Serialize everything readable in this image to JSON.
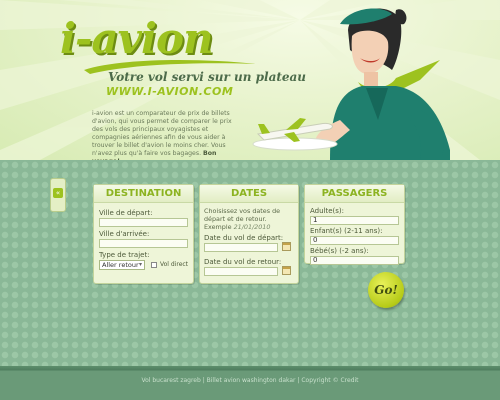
{
  "header": {
    "logo": "i-avion",
    "tagline": "Votre vol servi sur un plateau",
    "url": "WWW.I-AVION.COM",
    "intro": "i-avion est un comparateur de prix de billets d'avion, qui vous permet de comparer le prix des vols des principaux voyagistes et compagnies aériennes afin de vous aider à trouver le billet d'avion le moins cher. Vous n'avez plus qu'à faire vos bagages.",
    "intro_bold": "Bon voyage!"
  },
  "destination": {
    "title": "Destination",
    "departure_label": "Ville de départ:",
    "departure_value": "",
    "arrival_label": "Ville d'arrivée:",
    "arrival_value": "",
    "trip_type_label": "Type de trajet:",
    "trip_type_value": "Aller retour",
    "direct_label": "Vol direct"
  },
  "dates": {
    "title": "Dates",
    "instructions": "Choisissez vos dates de départ et de retour. Exemple",
    "example": "21/01/2010",
    "departure_label": "Date du vol de départ:",
    "departure_value": "",
    "return_label": "Date du vol de retour:",
    "return_value": ""
  },
  "passengers": {
    "title": "Passagers",
    "adults_label": "Adulte(s):",
    "adults_value": "1",
    "children_label": "Enfant(s) (2-11 ans):",
    "children_value": "0",
    "babies_label": "Bébé(s) (-2 ans):",
    "babies_value": "0"
  },
  "go_button": "Go!",
  "footer": {
    "links": "Vol bucarest zagreb | Billet avion washington dakar | Copyright © Credit"
  },
  "colors": {
    "brand_green": "#9dc21f",
    "form_bg": "#8ab897",
    "panel_bg": "#eef5d8"
  }
}
